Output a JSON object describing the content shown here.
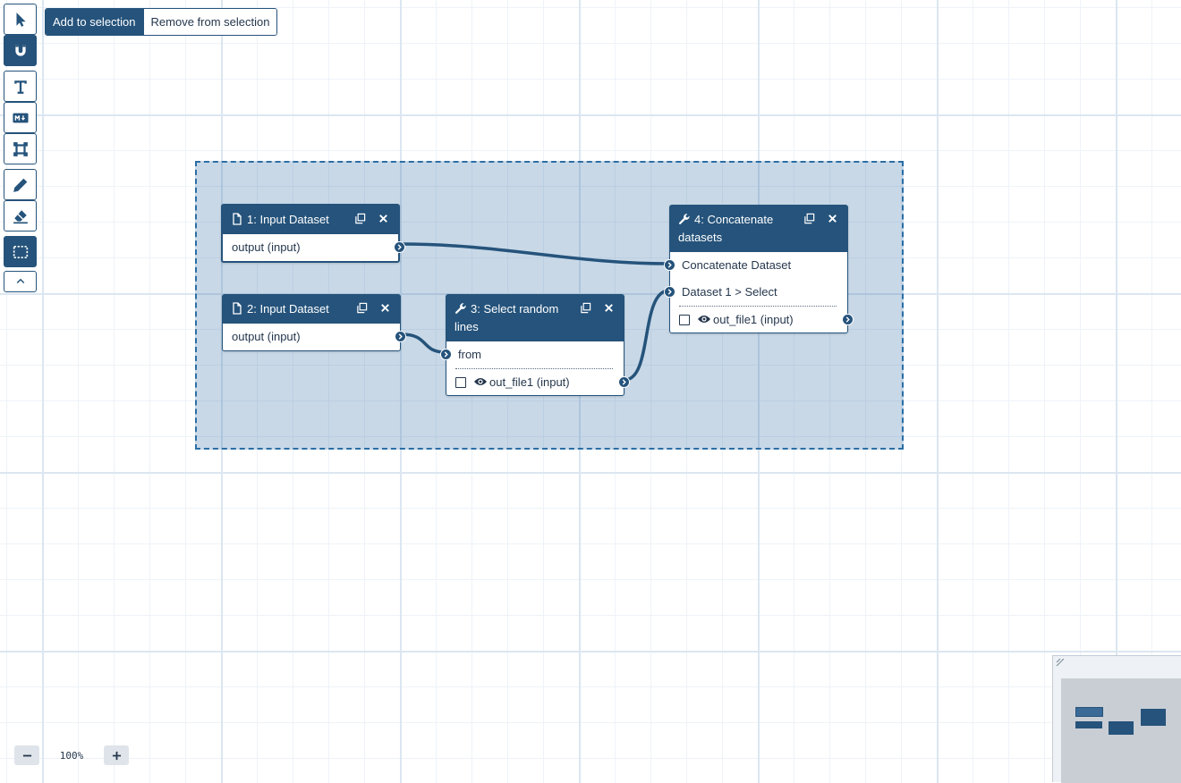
{
  "toolbar": {
    "tools": [
      {
        "name": "pointer",
        "icon": "pointer-icon"
      },
      {
        "name": "snap",
        "icon": "magnet-icon"
      },
      {
        "name": "text",
        "icon": "text-icon"
      },
      {
        "name": "markdown",
        "icon": "markdown-icon"
      },
      {
        "name": "frame",
        "icon": "frame-icon"
      },
      {
        "name": "freehand",
        "icon": "pencil-icon"
      },
      {
        "name": "eraser",
        "icon": "eraser-icon"
      },
      {
        "name": "box-select",
        "icon": "box-select-icon"
      },
      {
        "name": "collapse",
        "icon": "chevron-up-icon"
      }
    ]
  },
  "selection_mode": {
    "add_label": "Add to selection",
    "remove_label": "Remove from selection"
  },
  "nodes": {
    "n1": {
      "title": "1: Input Dataset",
      "outputs": [
        "output (input)"
      ]
    },
    "n2": {
      "title": "2: Input Dataset",
      "outputs": [
        "output (input)"
      ]
    },
    "n3": {
      "title": "3: Select random lines",
      "inputs": [
        "from"
      ],
      "outputs": [
        "out_file1 (input)"
      ]
    },
    "n4": {
      "title": "4: Concatenate datasets",
      "inputs": [
        "Concatenate Dataset",
        "Dataset 1 > Select"
      ],
      "outputs": [
        "out_file1 (input)"
      ]
    }
  },
  "zoom": {
    "level": "100%",
    "minus_label": "−",
    "plus_label": "+"
  },
  "colors": {
    "accent": "#25537b",
    "selection_fill": "#c4d8ea",
    "selection_border": "#2b6ea5",
    "grid": "#dbe6f1"
  }
}
